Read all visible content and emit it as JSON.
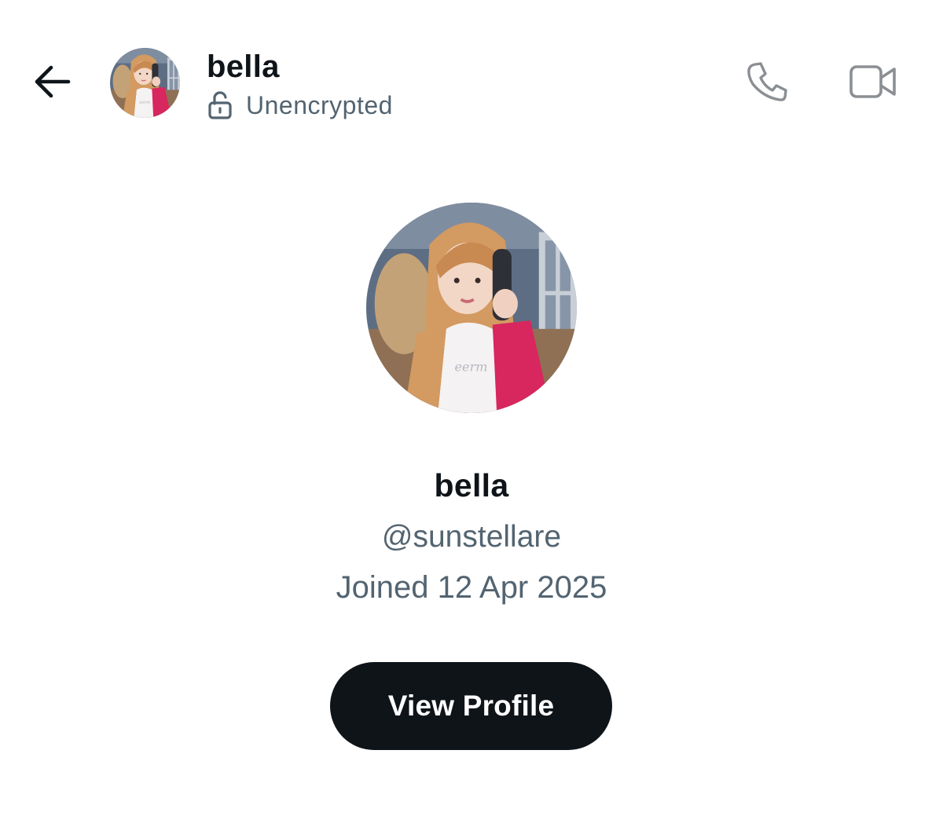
{
  "header": {
    "name": "bella",
    "encryption_status": "Unencrypted",
    "back_icon": "arrow-left-icon",
    "lock_icon": "unlocked-padlock-icon",
    "call_icon": "phone-icon",
    "video_icon": "video-camera-icon"
  },
  "profile": {
    "name": "bella",
    "handle": "@sunstellare",
    "joined": "Joined 12 Apr 2025",
    "view_profile_label": "View Profile",
    "avatar_icon": "profile-photo"
  },
  "colors": {
    "primary_text": "#0f1419",
    "secondary_text": "#536471",
    "icon_gray": "#8b8f93",
    "button_background": "#0f1419",
    "button_text": "#ffffff"
  }
}
